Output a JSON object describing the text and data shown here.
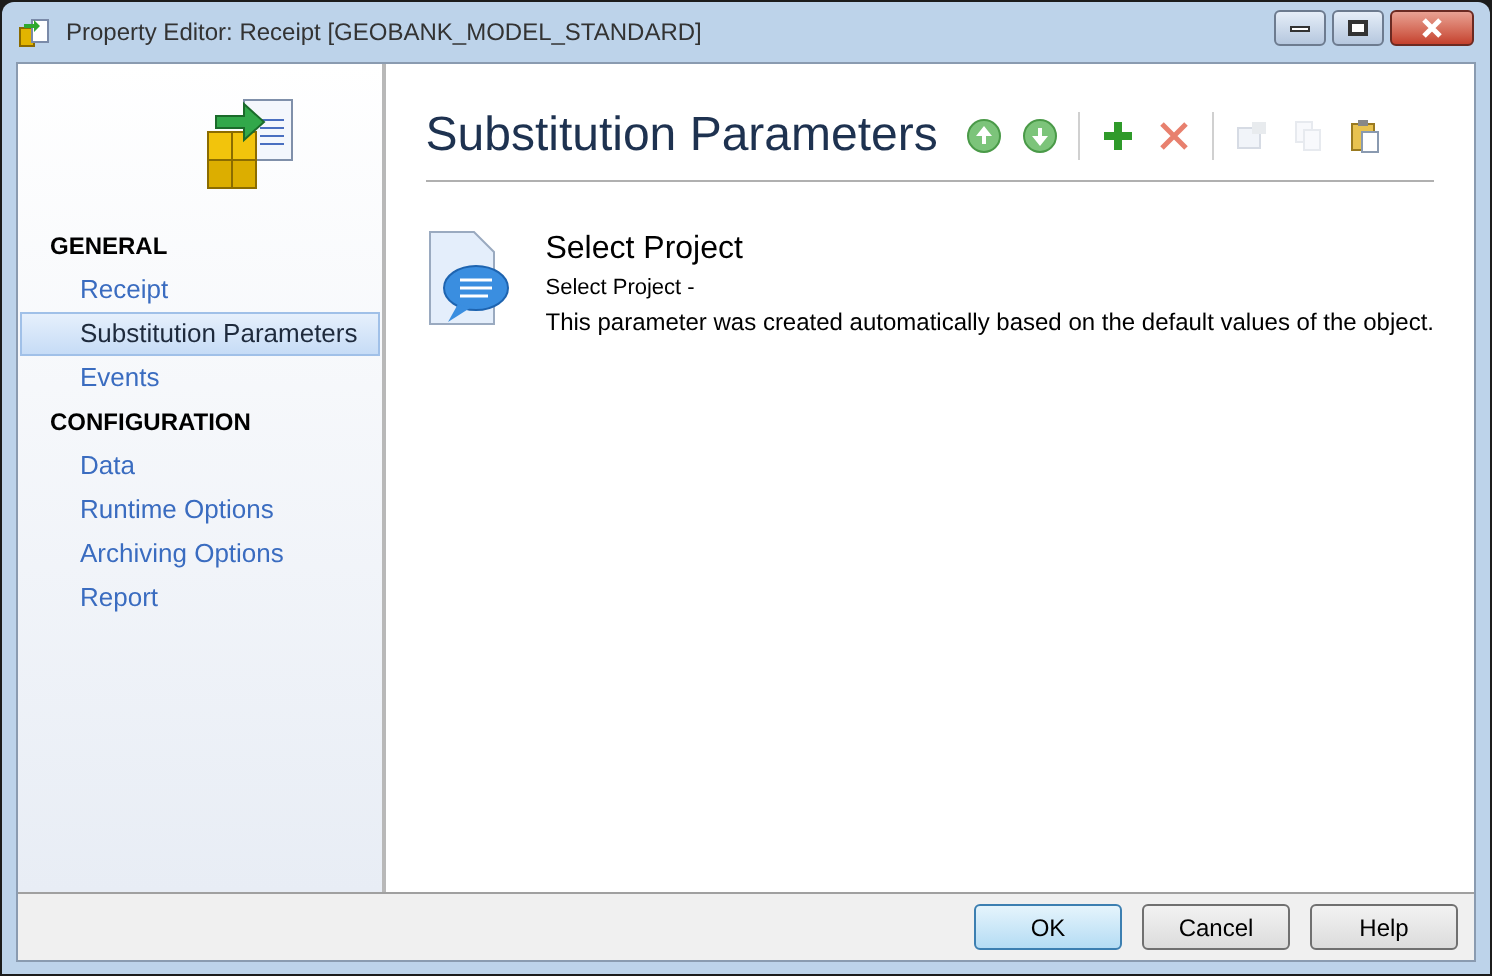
{
  "window": {
    "title": "Property Editor: Receipt [GEOBANK_MODEL_STANDARD]"
  },
  "sidebar": {
    "sections": [
      {
        "heading": "GENERAL",
        "items": [
          {
            "label": "Receipt",
            "selected": false
          },
          {
            "label": "Substitution Parameters",
            "selected": true
          },
          {
            "label": "Events",
            "selected": false
          }
        ]
      },
      {
        "heading": "CONFIGURATION",
        "items": [
          {
            "label": "Data",
            "selected": false
          },
          {
            "label": "Runtime Options",
            "selected": false
          },
          {
            "label": "Archiving Options",
            "selected": false
          },
          {
            "label": "Report",
            "selected": false
          }
        ]
      }
    ]
  },
  "page": {
    "title": "Substitution Parameters",
    "toolbar": [
      {
        "kind": "up",
        "disabled": false
      },
      {
        "kind": "down",
        "disabled": false
      },
      {
        "kind": "separator"
      },
      {
        "kind": "add",
        "disabled": false
      },
      {
        "kind": "delete",
        "disabled": false
      },
      {
        "kind": "separator"
      },
      {
        "kind": "properties",
        "disabled": true
      },
      {
        "kind": "copy",
        "disabled": true
      },
      {
        "kind": "paste",
        "disabled": false
      }
    ],
    "parameters": [
      {
        "name": "Select Project",
        "caption": "Select Project -",
        "description": "This parameter was created automatically based on the default values of the object."
      }
    ]
  },
  "buttons": [
    {
      "label": "OK",
      "default": true
    },
    {
      "label": "Cancel",
      "default": false
    },
    {
      "label": "Help",
      "default": false
    }
  ]
}
